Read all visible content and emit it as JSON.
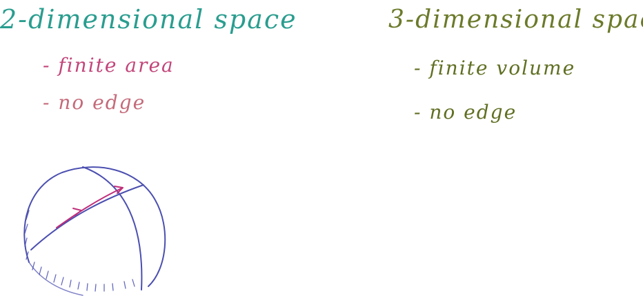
{
  "left_column": {
    "heading": "2-dimensional space",
    "items": [
      "- finite area",
      "- no edge"
    ],
    "heading_color": "#2a9d8f",
    "item_color": "#c2457a"
  },
  "right_column": {
    "heading": "3-dimensional spac",
    "items": [
      "- finite volume",
      "- no edge"
    ],
    "color": "#5f6f22"
  },
  "sketch": {
    "name": "hemisphere-sketch",
    "outline_color": "#4b4fb0",
    "path_color": "#c02e7a"
  }
}
